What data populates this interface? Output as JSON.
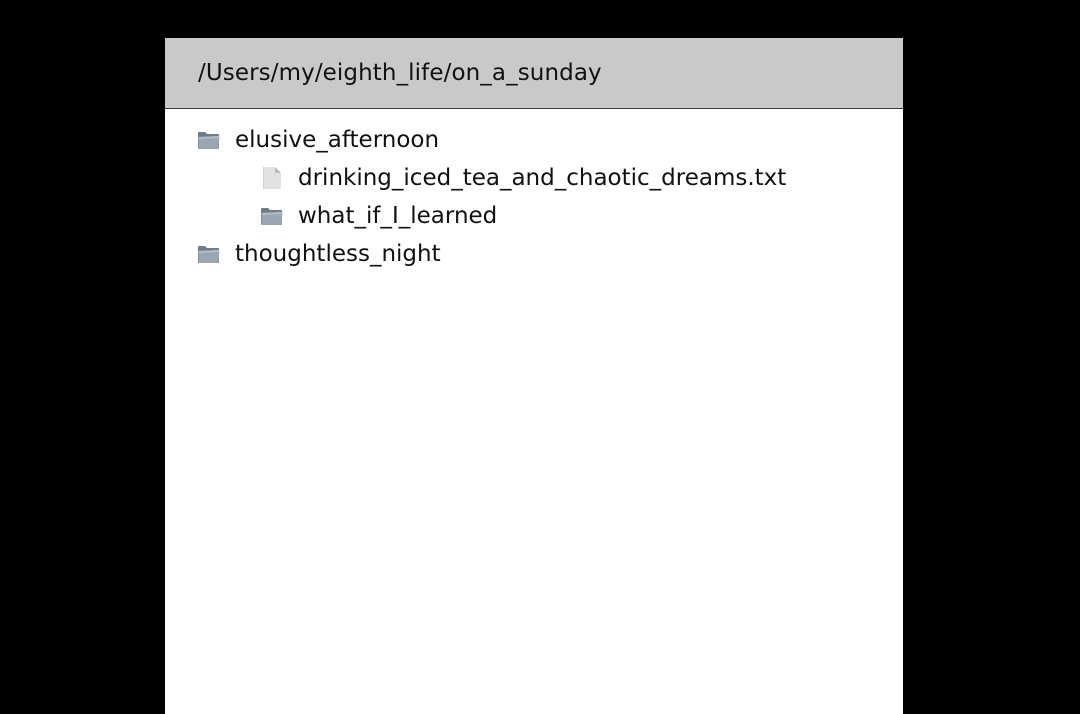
{
  "path_bar": {
    "path": "/Users/my/eighth_life/on_a_sunday"
  },
  "tree": {
    "items": [
      {
        "name": "elusive_afternoon",
        "type": "folder",
        "icon": "folder-icon"
      },
      {
        "name": "drinking_iced_tea_and_chaotic_dreams.txt",
        "type": "file",
        "icon": "file-icon"
      },
      {
        "name": "what_if_I_learned",
        "type": "folder",
        "icon": "folder-icon"
      },
      {
        "name": "thoughtless_night",
        "type": "folder",
        "icon": "folder-icon"
      }
    ]
  },
  "colors": {
    "background": "#000000",
    "path_bar": "#c9c9c9",
    "panel": "#ffffff",
    "folder": "#7d8a96",
    "file": "#d8d8d8"
  }
}
